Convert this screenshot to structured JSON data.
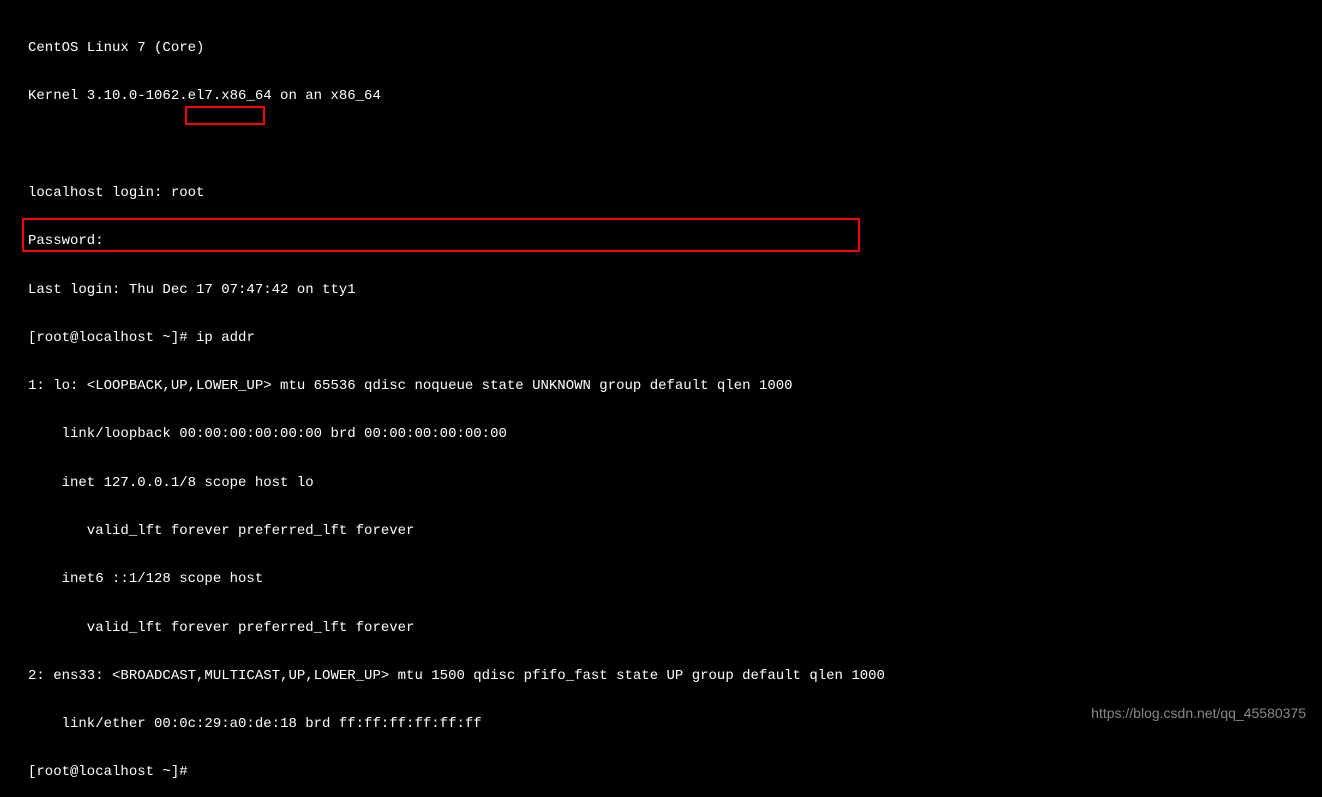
{
  "header": {
    "os_line": "CentOS Linux 7 (Core)",
    "kernel_line": "Kernel 3.10.0-1062.el7.x86_64 on an x86_64"
  },
  "login": {
    "login_prompt": "localhost login: root",
    "password_prompt": "Password:",
    "last_login": "Last login: Thu Dec 17 07:47:42 on tty1"
  },
  "prompt1": {
    "prefix": "[root@localhost ~]# ",
    "command": "ip addr"
  },
  "output": {
    "lo_header": "1: lo: <LOOPBACK,UP,LOWER_UP> mtu 65536 qdisc noqueue state UNKNOWN group default qlen 1000",
    "lo_link": "    link/loopback 00:00:00:00:00:00 brd 00:00:00:00:00:00",
    "lo_inet": "    inet 127.0.0.1/8 scope host lo",
    "lo_valid1": "       valid_lft forever preferred_lft forever",
    "lo_inet6": "    inet6 ::1/128 scope host",
    "lo_valid2": "       valid_lft forever preferred_lft forever",
    "ens_header": "2: ens33: <BROADCAST,MULTICAST,UP,LOWER_UP> mtu 1500 qdisc pfifo_fast state UP group default qlen 1000",
    "ens_link": "    link/ether 00:0c:29:a0:de:18 brd ff:ff:ff:ff:ff:ff"
  },
  "prompt2": {
    "text": "[root@localhost ~]#"
  },
  "watermark": "https://blog.csdn.net/qq_45580375"
}
